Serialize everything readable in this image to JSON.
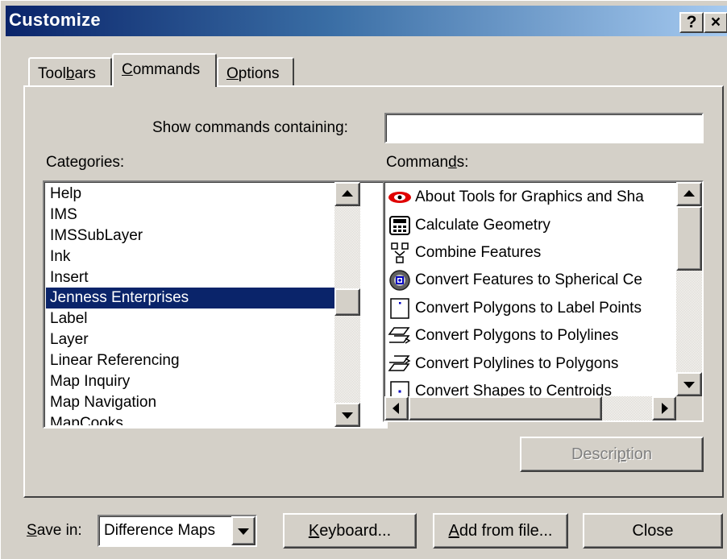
{
  "window": {
    "title": "Customize",
    "help_label": "?",
    "close_label": "×"
  },
  "tabs": [
    {
      "label": "Toolbars",
      "accel_pre": "Tool",
      "accel": "b",
      "accel_post": "ars"
    },
    {
      "label": "Commands",
      "accel_pre": "",
      "accel": "C",
      "accel_post": "ommands",
      "active": true
    },
    {
      "label": "Options",
      "accel_pre": "",
      "accel": "O",
      "accel_post": "ptions"
    }
  ],
  "search": {
    "label": "Show commands containing:",
    "value": ""
  },
  "categories": {
    "label_pre": "Cate",
    "label_accel": "g",
    "label_post": "ories:",
    "items": [
      "Help",
      "IMS",
      "IMSSubLayer",
      "Ink",
      "Insert",
      "Jenness Enterprises",
      "Label",
      "Layer",
      "Linear Referencing",
      "Map Inquiry",
      "Map Navigation",
      "MapCooks"
    ],
    "selected": "Jenness Enterprises"
  },
  "commands": {
    "label_pre": "Comman",
    "label_accel": "d",
    "label_post": "s:",
    "items": [
      {
        "label": "About Tools for Graphics and Sha",
        "icon": "eye-icon"
      },
      {
        "label": "Calculate Geometry",
        "icon": "calculator-icon"
      },
      {
        "label": "Combine Features",
        "icon": "combine-icon"
      },
      {
        "label": "Convert Features to Spherical Ce",
        "icon": "sphere-icon"
      },
      {
        "label": "Convert Polygons to Label Points",
        "icon": "label-point-icon"
      },
      {
        "label": "Convert Polygons to Polylines",
        "icon": "polygon-polyline-icon"
      },
      {
        "label": "Convert Polylines to Polygons",
        "icon": "polyline-polygon-icon"
      },
      {
        "label": "Convert Shapes to Centroids",
        "icon": "centroid-icon"
      }
    ]
  },
  "description_button": {
    "pre": "Descri",
    "accel": "p",
    "post": "tion",
    "enabled": false
  },
  "save_in": {
    "label_accel": "S",
    "label_post": "ave in:",
    "value": "Difference Maps"
  },
  "buttons": {
    "keyboard": {
      "accel": "K",
      "post": "eyboard..."
    },
    "add_from_file": {
      "accel": "A",
      "post": "dd from file..."
    },
    "close": "Close"
  }
}
